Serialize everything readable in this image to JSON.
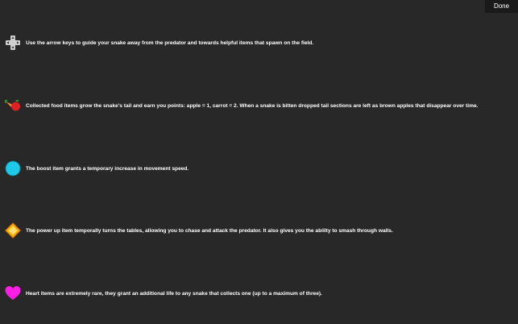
{
  "header": {
    "done_label": "Done"
  },
  "instructions": [
    {
      "icon": "arrow-keys-icon",
      "text": "Use the arrow keys to guide your snake away from the predator and towards helpful items that spawn on the field."
    },
    {
      "icon": "food-items-icon",
      "text": "Collected food items grow the snake's tail and earn you points: apple = 1, carrot = 2. When a snake is bitten dropped tail sections are left as brown apples that disappear over time."
    },
    {
      "icon": "boost-icon",
      "text": "The boost item grants a temporary increase in movement speed."
    },
    {
      "icon": "power-up-icon",
      "text": "The power up item temporally turns the tables, allowing you to chase and attack the predator. It also gives you the ability to smash through walls."
    },
    {
      "icon": "heart-icon",
      "text": "Heart items are extremely rare, they grant an additional life to any snake that collects one (up to a maximum of three)."
    }
  ],
  "colors": {
    "background": "#282828",
    "done_button_bg": "#1a1a1a",
    "boost": "#1ec8e8",
    "power_up": "#f5b400",
    "heart": "#ff1ee6",
    "apple": "#e02020",
    "carrot": "#f08a1c"
  }
}
